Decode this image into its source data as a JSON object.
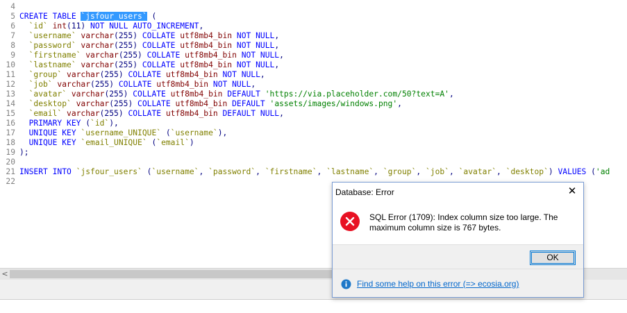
{
  "editor": {
    "lines": [
      {
        "num": "4",
        "tokens": []
      },
      {
        "num": "5",
        "tokens": [
          {
            "t": "CREATE TABLE ",
            "c": "kw"
          },
          {
            "t": "`jsfour_users`",
            "c": "sel"
          },
          {
            "t": " (",
            "c": "pu"
          }
        ]
      },
      {
        "num": "6",
        "tokens": [
          {
            "t": "  `id` ",
            "c": "id"
          },
          {
            "t": "int",
            "c": "ty"
          },
          {
            "t": "(11) ",
            "c": "pu"
          },
          {
            "t": "NOT NULL AUTO_INCREMENT",
            "c": "kw"
          },
          {
            "t": ",",
            "c": "pu"
          }
        ]
      },
      {
        "num": "7",
        "tokens": [
          {
            "t": "  `username` ",
            "c": "id"
          },
          {
            "t": "varchar",
            "c": "ty"
          },
          {
            "t": "(255) ",
            "c": "pu"
          },
          {
            "t": "COLLATE ",
            "c": "kw"
          },
          {
            "t": "utf8mb4_bin ",
            "c": "ty"
          },
          {
            "t": "NOT NULL",
            "c": "kw"
          },
          {
            "t": ",",
            "c": "pu"
          }
        ]
      },
      {
        "num": "8",
        "tokens": [
          {
            "t": "  `password` ",
            "c": "id"
          },
          {
            "t": "varchar",
            "c": "ty"
          },
          {
            "t": "(255) ",
            "c": "pu"
          },
          {
            "t": "COLLATE ",
            "c": "kw"
          },
          {
            "t": "utf8mb4_bin ",
            "c": "ty"
          },
          {
            "t": "NOT NULL",
            "c": "kw"
          },
          {
            "t": ",",
            "c": "pu"
          }
        ]
      },
      {
        "num": "9",
        "tokens": [
          {
            "t": "  `firstname` ",
            "c": "id"
          },
          {
            "t": "varchar",
            "c": "ty"
          },
          {
            "t": "(255) ",
            "c": "pu"
          },
          {
            "t": "COLLATE ",
            "c": "kw"
          },
          {
            "t": "utf8mb4_bin ",
            "c": "ty"
          },
          {
            "t": "NOT NULL",
            "c": "kw"
          },
          {
            "t": ",",
            "c": "pu"
          }
        ]
      },
      {
        "num": "10",
        "tokens": [
          {
            "t": "  `lastname` ",
            "c": "id"
          },
          {
            "t": "varchar",
            "c": "ty"
          },
          {
            "t": "(255) ",
            "c": "pu"
          },
          {
            "t": "COLLATE ",
            "c": "kw"
          },
          {
            "t": "utf8mb4_bin ",
            "c": "ty"
          },
          {
            "t": "NOT NULL",
            "c": "kw"
          },
          {
            "t": ",",
            "c": "pu"
          }
        ]
      },
      {
        "num": "11",
        "tokens": [
          {
            "t": "  `group` ",
            "c": "id"
          },
          {
            "t": "varchar",
            "c": "ty"
          },
          {
            "t": "(255) ",
            "c": "pu"
          },
          {
            "t": "COLLATE ",
            "c": "kw"
          },
          {
            "t": "utf8mb4_bin ",
            "c": "ty"
          },
          {
            "t": "NOT NULL",
            "c": "kw"
          },
          {
            "t": ",",
            "c": "pu"
          }
        ]
      },
      {
        "num": "12",
        "tokens": [
          {
            "t": "  `job` ",
            "c": "id"
          },
          {
            "t": "varchar",
            "c": "ty"
          },
          {
            "t": "(255) ",
            "c": "pu"
          },
          {
            "t": "COLLATE ",
            "c": "kw"
          },
          {
            "t": "utf8mb4_bin ",
            "c": "ty"
          },
          {
            "t": "NOT NULL",
            "c": "kw"
          },
          {
            "t": ",",
            "c": "pu"
          }
        ]
      },
      {
        "num": "13",
        "tokens": [
          {
            "t": "  `avatar` ",
            "c": "id"
          },
          {
            "t": "varchar",
            "c": "ty"
          },
          {
            "t": "(255) ",
            "c": "pu"
          },
          {
            "t": "COLLATE ",
            "c": "kw"
          },
          {
            "t": "utf8mb4_bin ",
            "c": "ty"
          },
          {
            "t": "DEFAULT ",
            "c": "kw"
          },
          {
            "t": "'https://via.placeholder.com/50?text=A'",
            "c": "st"
          },
          {
            "t": ",",
            "c": "pu"
          }
        ]
      },
      {
        "num": "14",
        "tokens": [
          {
            "t": "  `desktop` ",
            "c": "id"
          },
          {
            "t": "varchar",
            "c": "ty"
          },
          {
            "t": "(255) ",
            "c": "pu"
          },
          {
            "t": "COLLATE ",
            "c": "kw"
          },
          {
            "t": "utf8mb4_bin ",
            "c": "ty"
          },
          {
            "t": "DEFAULT ",
            "c": "kw"
          },
          {
            "t": "'assets/images/windows.png'",
            "c": "st"
          },
          {
            "t": ",",
            "c": "pu"
          }
        ]
      },
      {
        "num": "15",
        "tokens": [
          {
            "t": "  `email` ",
            "c": "id"
          },
          {
            "t": "varchar",
            "c": "ty"
          },
          {
            "t": "(255) ",
            "c": "pu"
          },
          {
            "t": "COLLATE ",
            "c": "kw"
          },
          {
            "t": "utf8mb4_bin ",
            "c": "ty"
          },
          {
            "t": "DEFAULT NULL",
            "c": "kw"
          },
          {
            "t": ",",
            "c": "pu"
          }
        ]
      },
      {
        "num": "16",
        "tokens": [
          {
            "t": "  PRIMARY KEY ",
            "c": "kw"
          },
          {
            "t": "(",
            "c": "pu"
          },
          {
            "t": "`id`",
            "c": "id"
          },
          {
            "t": "),",
            "c": "pu"
          }
        ]
      },
      {
        "num": "17",
        "tokens": [
          {
            "t": "  UNIQUE KEY ",
            "c": "kw"
          },
          {
            "t": "`username_UNIQUE` ",
            "c": "id"
          },
          {
            "t": "(",
            "c": "pu"
          },
          {
            "t": "`username`",
            "c": "id"
          },
          {
            "t": "),",
            "c": "pu"
          }
        ]
      },
      {
        "num": "18",
        "tokens": [
          {
            "t": "  UNIQUE KEY ",
            "c": "kw"
          },
          {
            "t": "`email_UNIQUE` ",
            "c": "id"
          },
          {
            "t": "(",
            "c": "pu"
          },
          {
            "t": "`email`",
            "c": "id"
          },
          {
            "t": ")",
            "c": "pu"
          }
        ]
      },
      {
        "num": "19",
        "tokens": [
          {
            "t": ");",
            "c": "pu"
          }
        ]
      },
      {
        "num": "20",
        "tokens": []
      },
      {
        "num": "21",
        "tokens": [
          {
            "t": "INSERT INTO ",
            "c": "kw"
          },
          {
            "t": "`jsfour_users` ",
            "c": "id"
          },
          {
            "t": "(",
            "c": "pu"
          },
          {
            "t": "`username`",
            "c": "id"
          },
          {
            "t": ", ",
            "c": "pu"
          },
          {
            "t": "`password`",
            "c": "id"
          },
          {
            "t": ", ",
            "c": "pu"
          },
          {
            "t": "`firstname`",
            "c": "id"
          },
          {
            "t": ", ",
            "c": "pu"
          },
          {
            "t": "`lastname`",
            "c": "id"
          },
          {
            "t": ", ",
            "c": "pu"
          },
          {
            "t": "`group`",
            "c": "id"
          },
          {
            "t": ", ",
            "c": "pu"
          },
          {
            "t": "`job`",
            "c": "id"
          },
          {
            "t": ", ",
            "c": "pu"
          },
          {
            "t": "`avatar`",
            "c": "id"
          },
          {
            "t": ", ",
            "c": "pu"
          },
          {
            "t": "`desktop`",
            "c": "id"
          },
          {
            "t": ") ",
            "c": "pu"
          },
          {
            "t": "VALUES ",
            "c": "kw"
          },
          {
            "t": "(",
            "c": "pu"
          },
          {
            "t": "'ad",
            "c": "st"
          }
        ]
      },
      {
        "num": "22",
        "tokens": []
      }
    ]
  },
  "scrollbar": {
    "left_arrow": "<"
  },
  "dialog": {
    "title": "Database: Error",
    "close_glyph": "✕",
    "message": "SQL Error (1709): Index column size too large. The maximum column size is 767 bytes.",
    "ok_label": "OK",
    "help_link": "Find some help on this error (=> ecosia.org)",
    "error_icon": "error-x-icon",
    "info_icon": "info-icon",
    "colors": {
      "error_red": "#e81123",
      "info_blue": "#1e78c8",
      "link_blue": "#0066cc",
      "accent": "#0078d7"
    }
  }
}
